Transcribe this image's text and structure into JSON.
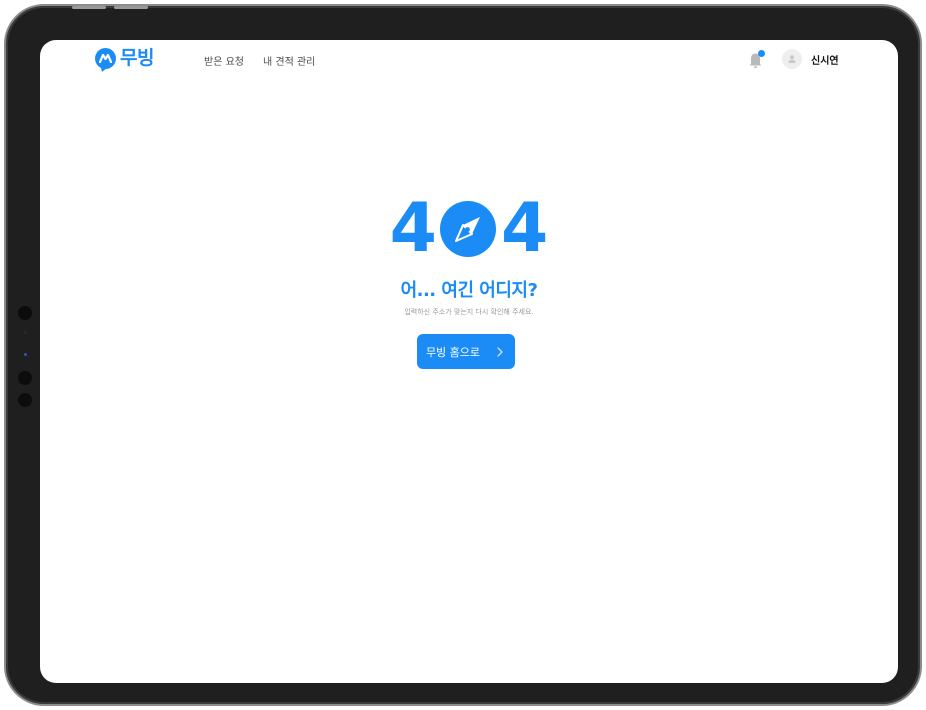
{
  "app": {
    "brand_name": "무빙",
    "brand_color": "#1b8cf6"
  },
  "header": {
    "nav": [
      {
        "label": "받은 요청"
      },
      {
        "label": "내 견적 관리"
      }
    ],
    "notification_icon": "bell-icon",
    "has_unread_notification": true,
    "user": {
      "avatar_icon": "user-avatar-icon",
      "name": "신시연"
    }
  },
  "error": {
    "code_left": "4",
    "code_icon": "compass-icon",
    "code_right": "4",
    "title": "어... 여긴 어디지?",
    "description": "입력하신 주소가 맞는지 다시 확인해 주세요.",
    "home_button_label": "무빙 홈으로",
    "home_button_icon": "chevron-right-icon"
  }
}
